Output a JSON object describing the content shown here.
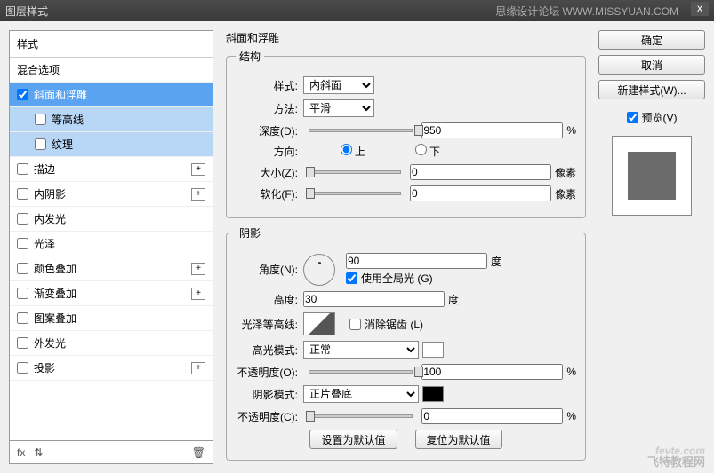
{
  "window": {
    "title": "图层样式",
    "forum": "思缘设计论坛",
    "forum_url": "WWW.MISSYUAN.COM",
    "close": "x"
  },
  "left": {
    "styles_header": "样式",
    "blend_header": "混合选项",
    "items": {
      "bevel": "斜面和浮雕",
      "contour": "等高线",
      "texture": "纹理",
      "stroke": "描边",
      "inner_shadow": "内阴影",
      "inner_glow": "内发光",
      "satin": "光泽",
      "color_overlay": "颜色叠加",
      "gradient_overlay": "渐变叠加",
      "pattern_overlay": "图案叠加",
      "outer_glow": "外发光",
      "drop_shadow": "投影"
    },
    "footer": {
      "fx": "fx",
      "arrows": "⇅",
      "trash": "🗑"
    }
  },
  "mid": {
    "title": "斜面和浮雕",
    "structure": {
      "legend": "结构",
      "style_label": "样式:",
      "style_value": "内斜面",
      "method_label": "方法:",
      "method_value": "平滑",
      "depth_label": "深度(D):",
      "depth_value": "950",
      "pct": "%",
      "direction_label": "方向:",
      "up": "上",
      "down": "下",
      "size_label": "大小(Z):",
      "size_value": "0",
      "px": "像素",
      "soften_label": "软化(F):",
      "soften_value": "0"
    },
    "shading": {
      "legend": "阴影",
      "angle_label": "角度(N):",
      "angle_value": "90",
      "deg": "度",
      "global_light": "使用全局光 (G)",
      "altitude_label": "高度:",
      "altitude_value": "30",
      "gloss_label": "光泽等高线:",
      "antialias": "消除锯齿 (L)",
      "highlight_mode_label": "高光模式:",
      "highlight_mode_value": "正常",
      "highlight_opacity_label": "不透明度(O):",
      "highlight_opacity_value": "100",
      "shadow_mode_label": "阴影模式:",
      "shadow_mode_value": "正片叠底",
      "shadow_opacity_label": "不透明度(C):",
      "shadow_opacity_value": "0"
    },
    "buttons": {
      "default": "设置为默认值",
      "reset": "复位为默认值"
    }
  },
  "right": {
    "ok": "确定",
    "cancel": "取消",
    "new_style": "新建样式(W)...",
    "preview_label": "预览(V)"
  },
  "watermark": {
    "main": "fevte.com",
    "sub": "飞特教程网"
  }
}
